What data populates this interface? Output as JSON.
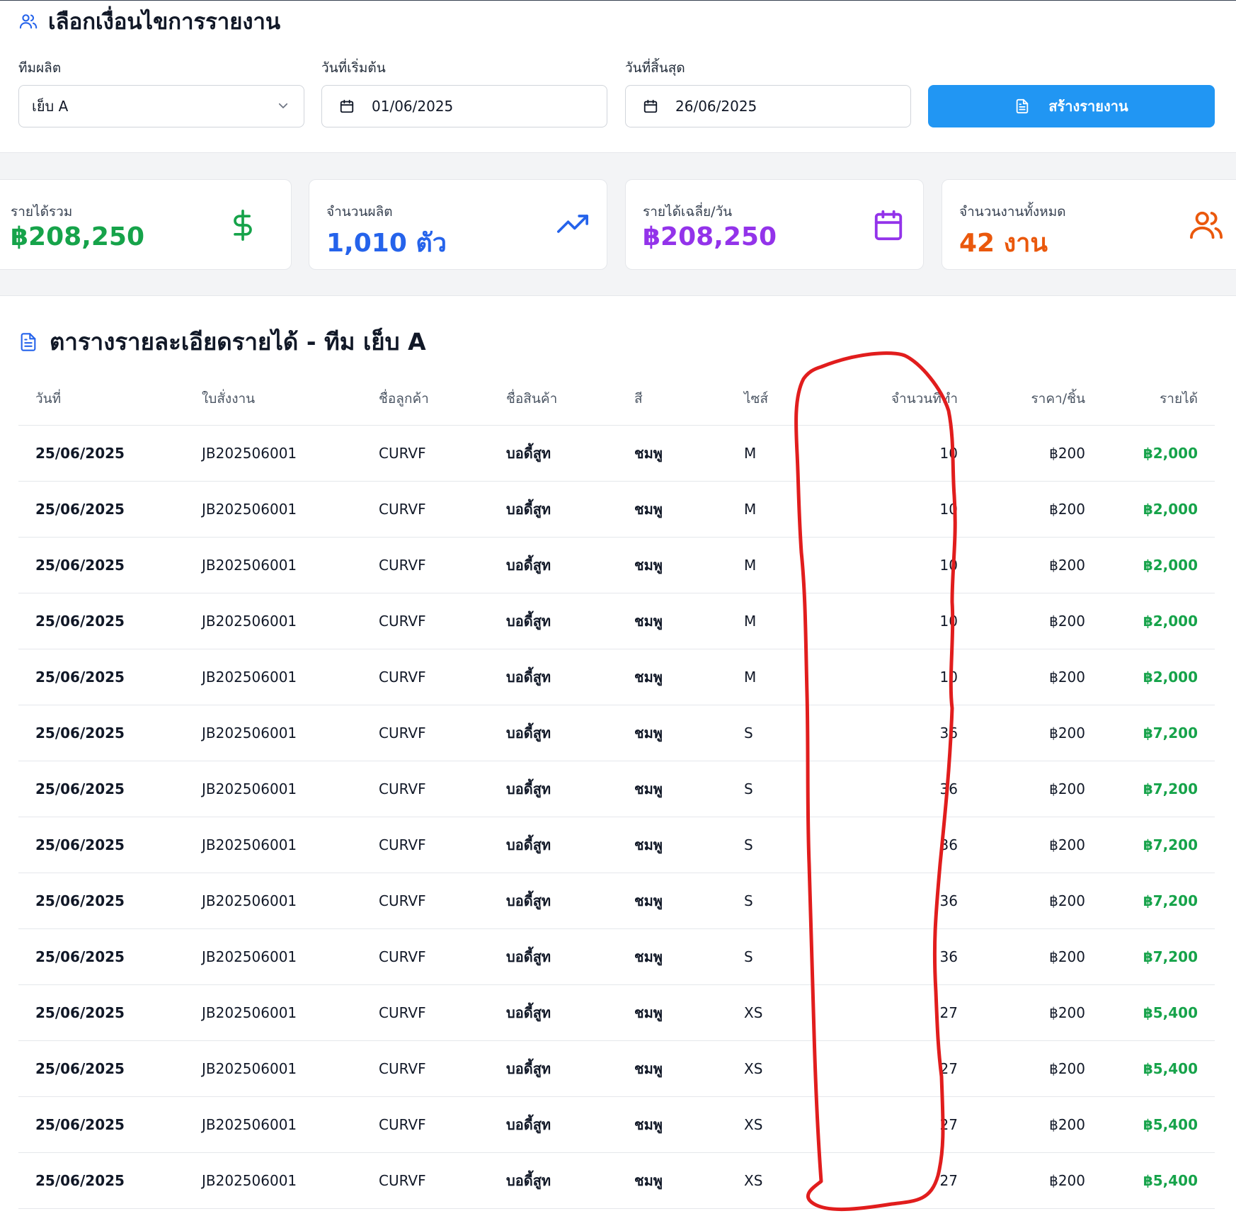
{
  "filter": {
    "title": "เลือกเงื่อนไขการรายงาน",
    "team_label": "ทีมผลิต",
    "team_value": "เย็บ A",
    "start_label": "วันที่เริ่มต้น",
    "start_value": "01/06/2025",
    "end_label": "วันที่สิ้นสุด",
    "end_value": "26/06/2025",
    "create_button": "สร้างรายงาน"
  },
  "stats": [
    {
      "label": "รายได้รวม",
      "value": "฿208,250",
      "color": "#16a34a",
      "icon": "dollar-icon"
    },
    {
      "label": "จำนวนผลิต",
      "value": "1,010 ตัว",
      "color": "#2563eb",
      "icon": "trending-up-icon"
    },
    {
      "label": "รายได้เฉลี่ย/วัน",
      "value": "฿208,250",
      "color": "#9333ea",
      "icon": "calendar-icon"
    },
    {
      "label": "จำนวนงานทั้งหมด",
      "value": "42 งาน",
      "color": "#ea580c",
      "icon": "users-icon"
    }
  ],
  "table": {
    "title": "ตารางรายละเอียดรายได้ - ทีม เย็บ A",
    "headers": [
      "วันที่",
      "ใบสั่งงาน",
      "ชื่อลูกค้า",
      "ชื่อสินค้า",
      "สี",
      "ไซส์",
      "จำนวนที่ทำ",
      "ราคา/ชิ้น",
      "รายได้"
    ],
    "rows": [
      [
        "25/06/2025",
        "JB202506001",
        "CURVF",
        "บอดี้สูท",
        "ชมพู",
        "M",
        "10",
        "฿200",
        "฿2,000"
      ],
      [
        "25/06/2025",
        "JB202506001",
        "CURVF",
        "บอดี้สูท",
        "ชมพู",
        "M",
        "10",
        "฿200",
        "฿2,000"
      ],
      [
        "25/06/2025",
        "JB202506001",
        "CURVF",
        "บอดี้สูท",
        "ชมพู",
        "M",
        "10",
        "฿200",
        "฿2,000"
      ],
      [
        "25/06/2025",
        "JB202506001",
        "CURVF",
        "บอดี้สูท",
        "ชมพู",
        "M",
        "10",
        "฿200",
        "฿2,000"
      ],
      [
        "25/06/2025",
        "JB202506001",
        "CURVF",
        "บอดี้สูท",
        "ชมพู",
        "M",
        "10",
        "฿200",
        "฿2,000"
      ],
      [
        "25/06/2025",
        "JB202506001",
        "CURVF",
        "บอดี้สูท",
        "ชมพู",
        "S",
        "36",
        "฿200",
        "฿7,200"
      ],
      [
        "25/06/2025",
        "JB202506001",
        "CURVF",
        "บอดี้สูท",
        "ชมพู",
        "S",
        "36",
        "฿200",
        "฿7,200"
      ],
      [
        "25/06/2025",
        "JB202506001",
        "CURVF",
        "บอดี้สูท",
        "ชมพู",
        "S",
        "36",
        "฿200",
        "฿7,200"
      ],
      [
        "25/06/2025",
        "JB202506001",
        "CURVF",
        "บอดี้สูท",
        "ชมพู",
        "S",
        "36",
        "฿200",
        "฿7,200"
      ],
      [
        "25/06/2025",
        "JB202506001",
        "CURVF",
        "บอดี้สูท",
        "ชมพู",
        "S",
        "36",
        "฿200",
        "฿7,200"
      ],
      [
        "25/06/2025",
        "JB202506001",
        "CURVF",
        "บอดี้สูท",
        "ชมพู",
        "XS",
        "27",
        "฿200",
        "฿5,400"
      ],
      [
        "25/06/2025",
        "JB202506001",
        "CURVF",
        "บอดี้สูท",
        "ชมพู",
        "XS",
        "27",
        "฿200",
        "฿5,400"
      ],
      [
        "25/06/2025",
        "JB202506001",
        "CURVF",
        "บอดี้สูท",
        "ชมพู",
        "XS",
        "27",
        "฿200",
        "฿5,400"
      ],
      [
        "25/06/2025",
        "JB202506001",
        "CURVF",
        "บอดี้สูท",
        "ชมพู",
        "XS",
        "27",
        "฿200",
        "฿5,400"
      ]
    ]
  },
  "colors": {
    "accent": "#2196f3",
    "income": "#16a34a",
    "annotation": "#e11d1d"
  }
}
